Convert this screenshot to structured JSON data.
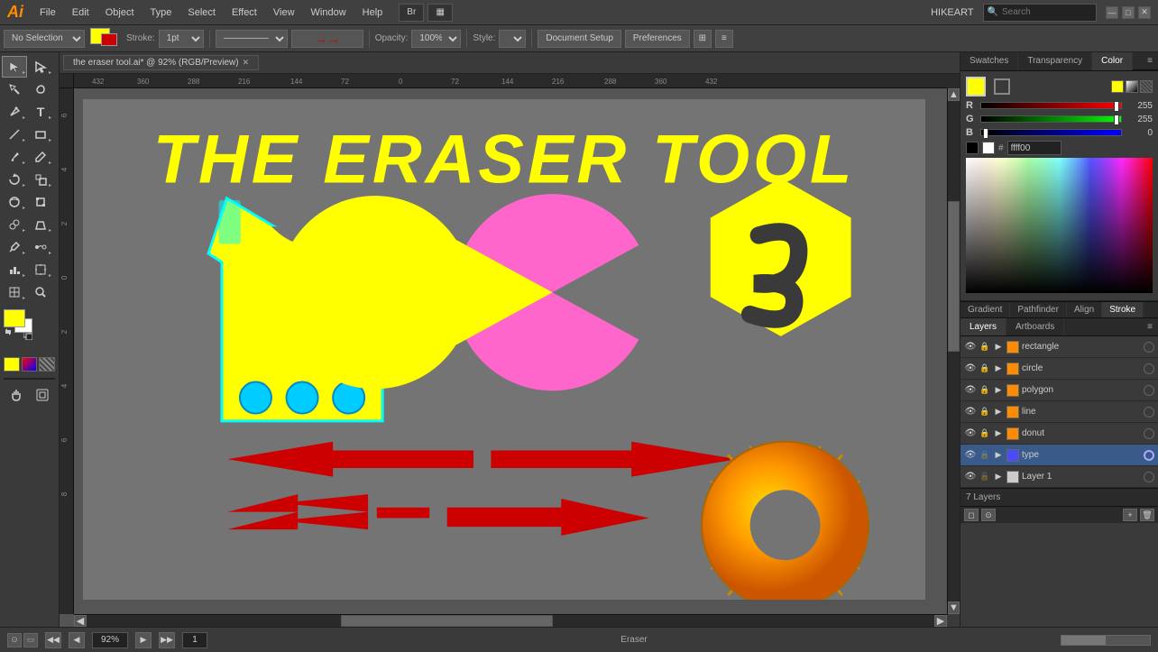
{
  "app": {
    "name": "Ai",
    "title": "HIKEART"
  },
  "menubar": {
    "menus": [
      "File",
      "Edit",
      "Object",
      "Type",
      "Select",
      "Effect",
      "View",
      "Window",
      "Help"
    ],
    "workspace_btn": "HIKEART",
    "search_placeholder": "Search"
  },
  "toolbar": {
    "selection": "No Selection",
    "fill_label": "",
    "stroke_label": "Stroke:",
    "opacity_label": "Opacity:",
    "opacity_value": "100%",
    "style_label": "Style:",
    "doc_setup_label": "Document Setup",
    "preferences_label": "Preferences"
  },
  "canvas": {
    "tab_title": "the eraser tool.ai* @ 92% (RGB/Preview)",
    "zoom": "92%",
    "tool_name": "Eraser",
    "page": "1",
    "total_pages": "1"
  },
  "artwork": {
    "title": "THE  ERASER  TOOL"
  },
  "color_panel": {
    "tabs": [
      "Swatches",
      "Transparency",
      "Color"
    ],
    "active_tab": "Color",
    "r_value": "255",
    "g_value": "255",
    "b_value": "0",
    "hex_value": "ffff00"
  },
  "lower_panel_tabs": [
    "Gradient",
    "Pathfinder",
    "Align",
    "Stroke"
  ],
  "layers_panel": {
    "tabs": [
      "Layers",
      "Artboards"
    ],
    "active_tab": "Layers",
    "layers": [
      {
        "name": "rectangle",
        "color": "#ff8c00",
        "visible": true,
        "locked": true,
        "selected": false
      },
      {
        "name": "circle",
        "color": "#ff8c00",
        "visible": true,
        "locked": true,
        "selected": false
      },
      {
        "name": "polygon",
        "color": "#ff8c00",
        "visible": true,
        "locked": true,
        "selected": false
      },
      {
        "name": "line",
        "color": "#ff8c00",
        "visible": true,
        "locked": true,
        "selected": false
      },
      {
        "name": "donut",
        "color": "#ff8c00",
        "visible": true,
        "locked": true,
        "selected": false
      },
      {
        "name": "type",
        "color": "#4a4aff",
        "visible": true,
        "locked": false,
        "selected": true
      },
      {
        "name": "Layer 1",
        "color": "#cccccc",
        "visible": true,
        "locked": false,
        "selected": false
      }
    ],
    "footer": "7 Layers"
  },
  "statusbar": {
    "zoom": "92%",
    "tool": "Eraser",
    "page": "1"
  },
  "tools": [
    {
      "name": "selection-tool",
      "icon": "↖",
      "label": "Selection"
    },
    {
      "name": "direct-selection-tool",
      "icon": "↗",
      "label": "Direct Selection"
    },
    {
      "name": "magic-wand-tool",
      "icon": "✦",
      "label": "Magic Wand"
    },
    {
      "name": "lasso-tool",
      "icon": "⌒",
      "label": "Lasso"
    },
    {
      "name": "pen-tool",
      "icon": "✒",
      "label": "Pen"
    },
    {
      "name": "type-tool",
      "icon": "T",
      "label": "Type"
    },
    {
      "name": "line-tool",
      "icon": "╱",
      "label": "Line"
    },
    {
      "name": "rectangle-tool",
      "icon": "▭",
      "label": "Rectangle"
    },
    {
      "name": "paintbrush-tool",
      "icon": "🖌",
      "label": "Paintbrush"
    },
    {
      "name": "pencil-tool",
      "icon": "✏",
      "label": "Pencil"
    },
    {
      "name": "rotate-tool",
      "icon": "↻",
      "label": "Rotate"
    },
    {
      "name": "scale-tool",
      "icon": "⤡",
      "label": "Scale"
    },
    {
      "name": "eraser-tool",
      "icon": "◻",
      "label": "Eraser"
    },
    {
      "name": "scissors-tool",
      "icon": "✂",
      "label": "Scissors"
    },
    {
      "name": "eyedropper-tool",
      "icon": "💉",
      "label": "Eyedropper"
    },
    {
      "name": "blend-tool",
      "icon": "⋮",
      "label": "Blend"
    },
    {
      "name": "gradient-tool",
      "icon": "◫",
      "label": "Gradient"
    },
    {
      "name": "zoom-tool",
      "icon": "🔍",
      "label": "Zoom"
    },
    {
      "name": "hand-tool",
      "icon": "✋",
      "label": "Hand"
    }
  ]
}
